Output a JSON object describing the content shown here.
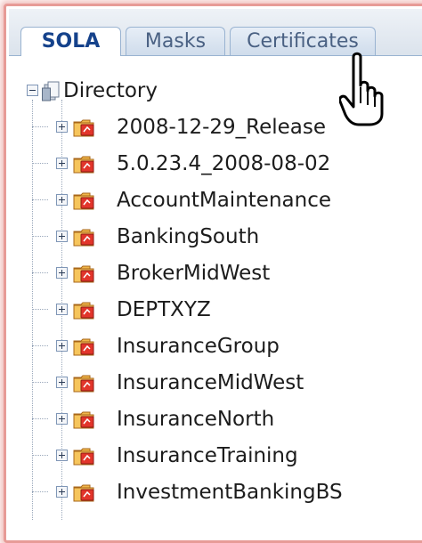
{
  "tabs": [
    {
      "label": "SOLA",
      "active": true
    },
    {
      "label": "Masks",
      "active": false
    },
    {
      "label": "Certificates",
      "active": false
    }
  ],
  "tree": {
    "root": {
      "label": "Directory",
      "icon": "directory-icon",
      "expanded": true
    },
    "items": [
      {
        "label": "2008-12-29_Release"
      },
      {
        "label": "5.0.23.4_2008-08-02"
      },
      {
        "label": "AccountMaintenance"
      },
      {
        "label": "BankingSouth"
      },
      {
        "label": "BrokerMidWest"
      },
      {
        "label": "DEPTXYZ"
      },
      {
        "label": "InsuranceGroup"
      },
      {
        "label": "InsuranceMidWest"
      },
      {
        "label": "InsuranceNorth"
      },
      {
        "label": "InsuranceTraining"
      },
      {
        "label": "InvestmentBankingBS"
      }
    ]
  },
  "colors": {
    "frame_border": "#e79b97",
    "tab_active_text": "#15428b",
    "tab_text": "#4a6183"
  },
  "cursor": "hand-pointer-icon"
}
